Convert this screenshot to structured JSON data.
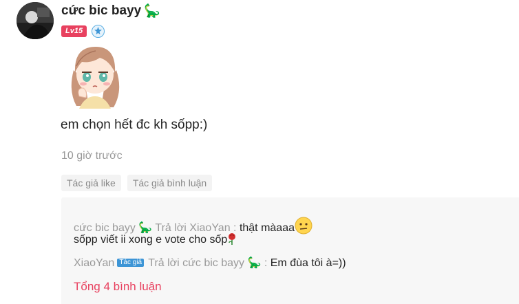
{
  "comment": {
    "username": "cức bic bayy",
    "username_emoji": "🦕",
    "level_badge": "Lv15",
    "rank_icon": "fan-rank-icon",
    "sticker": "anime-girl-thinking-sticker",
    "text": "em chọn hết đc kh sốpp:)",
    "time": "10 giờ trước",
    "tags": [
      "Tác giả like",
      "Tác giả bình luận"
    ]
  },
  "replies": {
    "items": [
      {
        "name": "cức bic bayy",
        "name_emoji": "🦕",
        "reply_to_label": "Trả lời XiaoYan :",
        "text": "thật màaaa",
        "text_line2": "sốpp viết ii xong e vote cho sốp"
      },
      {
        "name": "XiaoYan",
        "author_badge": "Tác giả",
        "reply_to_label": "Trả lời cức bic bayy",
        "reply_to_emoji": "🦕",
        "colon": ":",
        "text": "Em đùa tôi à=))"
      }
    ],
    "total_label": "Tổng 4 bình luận"
  },
  "colors": {
    "accent_pink": "#e8415f",
    "author_badge_blue": "#3d95d6",
    "muted_text": "#999999",
    "reply_bg": "#f7f7f7"
  }
}
